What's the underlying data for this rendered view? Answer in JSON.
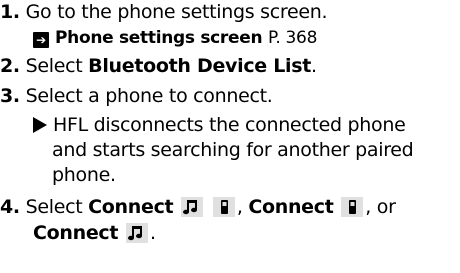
{
  "steps": [
    {
      "number": "1.",
      "text": "Go to the phone settings screen.",
      "reference": {
        "title": "Phone settings screen",
        "page": "P. 368"
      }
    },
    {
      "number": "2.",
      "text_before": "Select ",
      "bold": "Bluetooth Device List",
      "text_after": "."
    },
    {
      "number": "3.",
      "text": "Select a phone to connect.",
      "result_lines": [
        "HFL disconnects the connected phone",
        "and starts searching for another paired",
        "phone."
      ]
    },
    {
      "number": "4.",
      "text_before": "Select ",
      "connect_label": "Connect",
      "sep1": ", ",
      "sep2": ", or",
      "end": "."
    }
  ],
  "icons": {
    "reference": "reference-arrow-icon",
    "result": "result-triangle-icon",
    "music": "music-note-icon",
    "phone": "phone-icon"
  }
}
